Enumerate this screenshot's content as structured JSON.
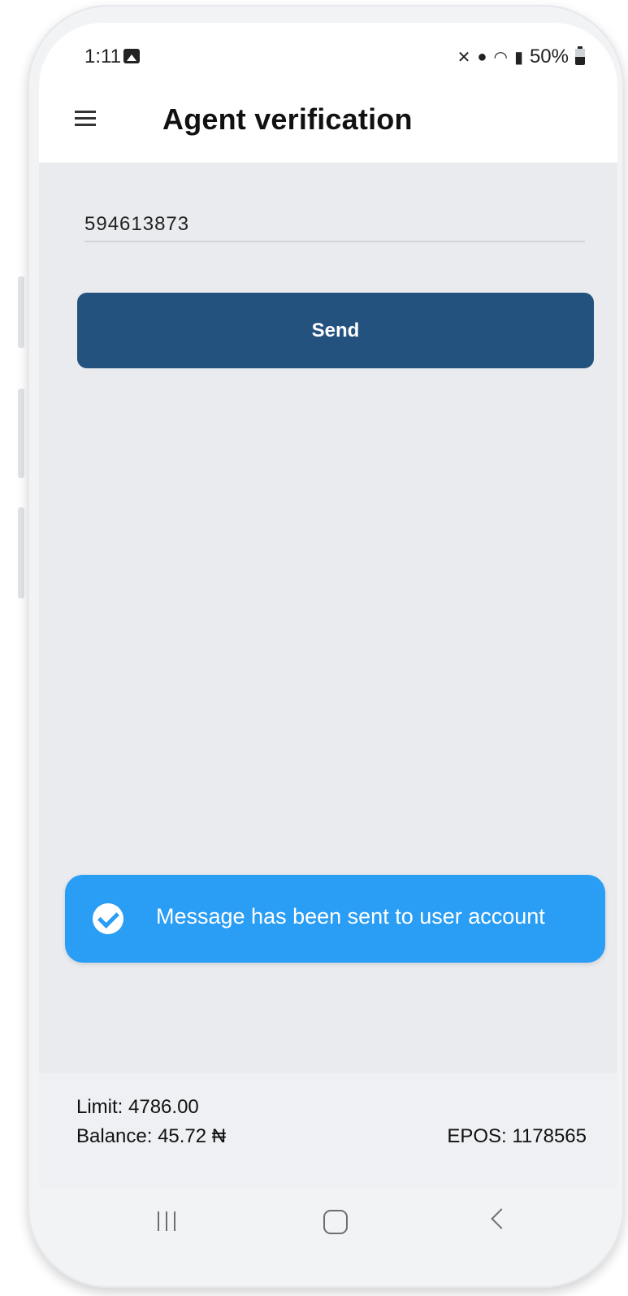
{
  "status_bar": {
    "time": "1:11",
    "battery": "50%",
    "icons": [
      "gallery-icon",
      "mute-icon",
      "location-icon",
      "wifi-icon",
      "signal-icon",
      "battery-icon"
    ]
  },
  "app_bar": {
    "title": "Agent verification",
    "menu_icon": "hamburger-menu-icon"
  },
  "form": {
    "field_value": "594613873",
    "send_label": "Send"
  },
  "toast": {
    "message": "Message has been sent to user account",
    "icon": "check-circle-icon"
  },
  "footer": {
    "limit": "Limit: 4786.00",
    "balance": "Balance: 45.72 ₦",
    "epos": "EPOS: 1178565"
  },
  "colors": {
    "primary": "#23527e",
    "toast": "#2a9df4",
    "background": "#e9ebef"
  }
}
